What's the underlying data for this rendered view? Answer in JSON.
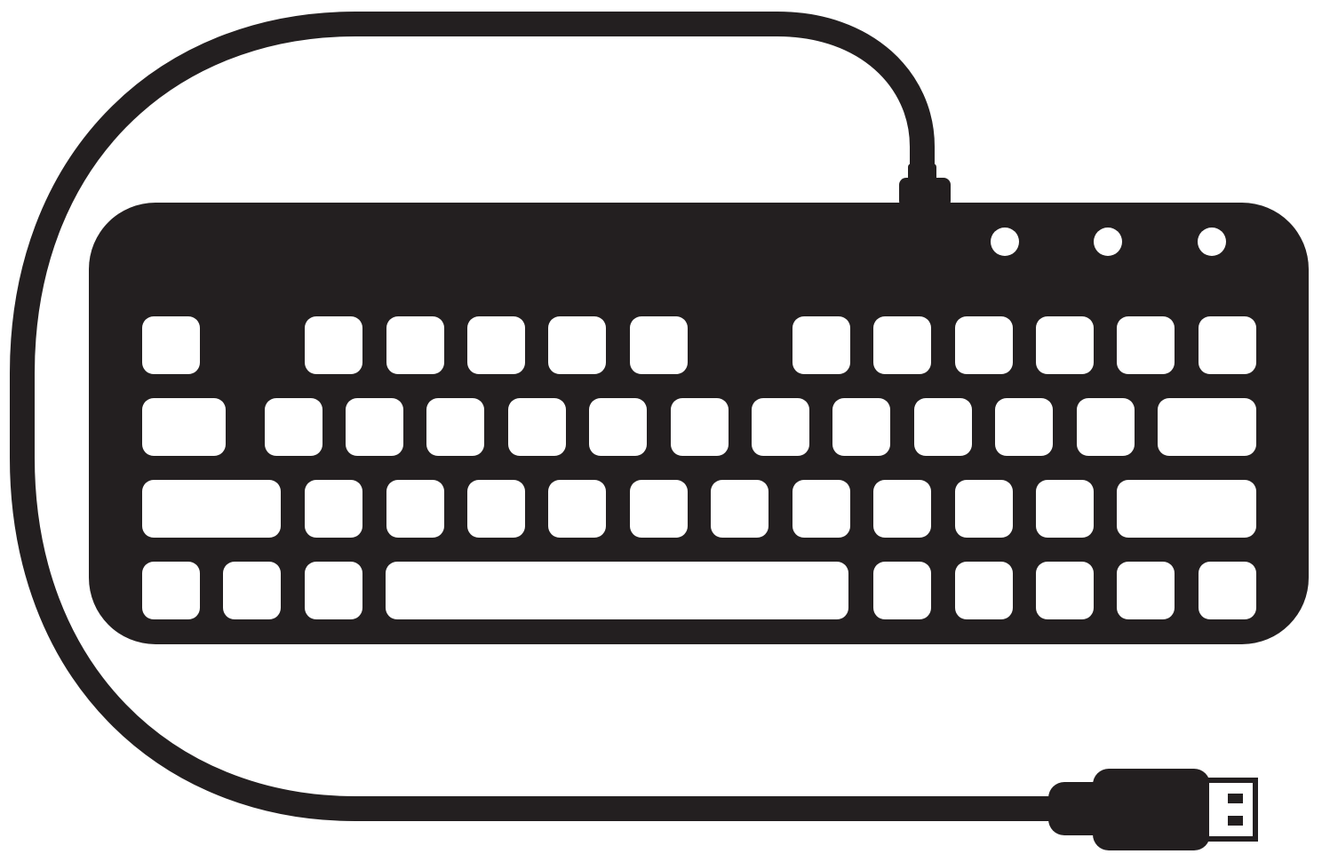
{
  "illustration": {
    "subject": "wired-usb-keyboard-icon",
    "colors": {
      "ink": "#231f20",
      "paper": "#ffffff"
    },
    "keyboard": {
      "indicator_lights": 3,
      "rows": [
        {
          "name": "function-row",
          "keys": 12
        },
        {
          "name": "number-row",
          "keys": 13
        },
        {
          "name": "letter-row",
          "keys": 12
        },
        {
          "name": "bottom-row",
          "keys": 9
        }
      ]
    },
    "cable": {
      "connector": "usb-plug-icon"
    }
  }
}
